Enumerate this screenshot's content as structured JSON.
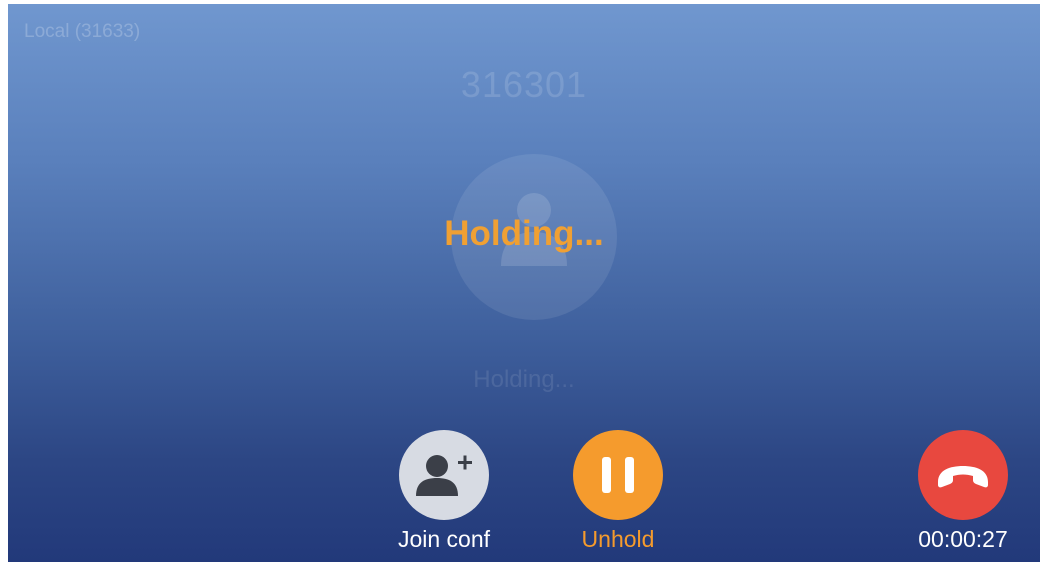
{
  "call": {
    "local_label": "Local (31633)",
    "remote_number": "316301",
    "status_overlay": "Holding...",
    "status_text": "Holding..."
  },
  "controls": {
    "join_conf_label": "Join conf",
    "unhold_label": "Unhold",
    "timer": "00:00:27"
  },
  "icons": {
    "join": "add-person-icon",
    "unhold": "pause-icon",
    "hangup": "hang-up-icon",
    "avatar": "person-icon"
  },
  "colors": {
    "accent_orange": "#f59b2d",
    "hangup_red": "#e8483f",
    "join_grey": "#d7dbe3"
  }
}
